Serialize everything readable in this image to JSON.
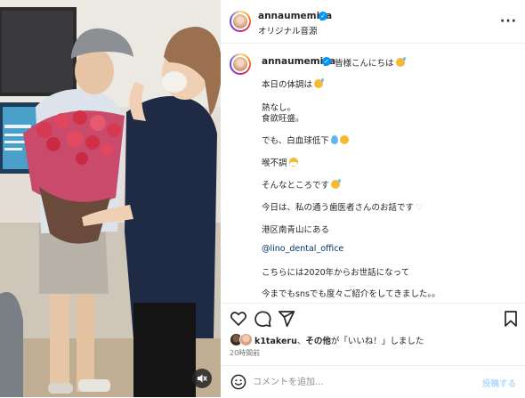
{
  "post": {
    "username": "annaumemiya",
    "audio": "オリジナル音源",
    "more_icon": "more-options-icon",
    "verified_icon": "verified-badge-icon"
  },
  "caption": {
    "greeting": "皆様こんにちは",
    "lines": [
      "本日の体調は",
      "熱なし。",
      "食欲旺盛。",
      "でも、白血球低下",
      "喉不調",
      "そんなところです",
      "今日は、私の通う歯医者さんのお話です",
      "港区南青山にある",
      "@lino_dental_office",
      "こちらには2020年からお世話になって",
      "今までもsnsでも度々ご紹介をしてきました。。"
    ]
  },
  "actions": {
    "like_icon": "heart-icon",
    "comment_icon": "comment-icon",
    "share_icon": "share-icon",
    "save_icon": "bookmark-icon"
  },
  "likes": {
    "user": "k1takeru",
    "sep": "、",
    "others": "その他",
    "suffix": "が「いいね！」しました"
  },
  "timestamp": "20時間前",
  "comment_box": {
    "placeholder": "コメントを追加...",
    "post_label": "投稿する",
    "emoji_icon": "emoji-icon"
  },
  "media": {
    "mute_icon": "speaker-muted-icon"
  },
  "colors": {
    "link": "#00376b",
    "verified": "#0095f6",
    "post_button_disabled": "#b3dbff",
    "muted_text": "#737373"
  }
}
